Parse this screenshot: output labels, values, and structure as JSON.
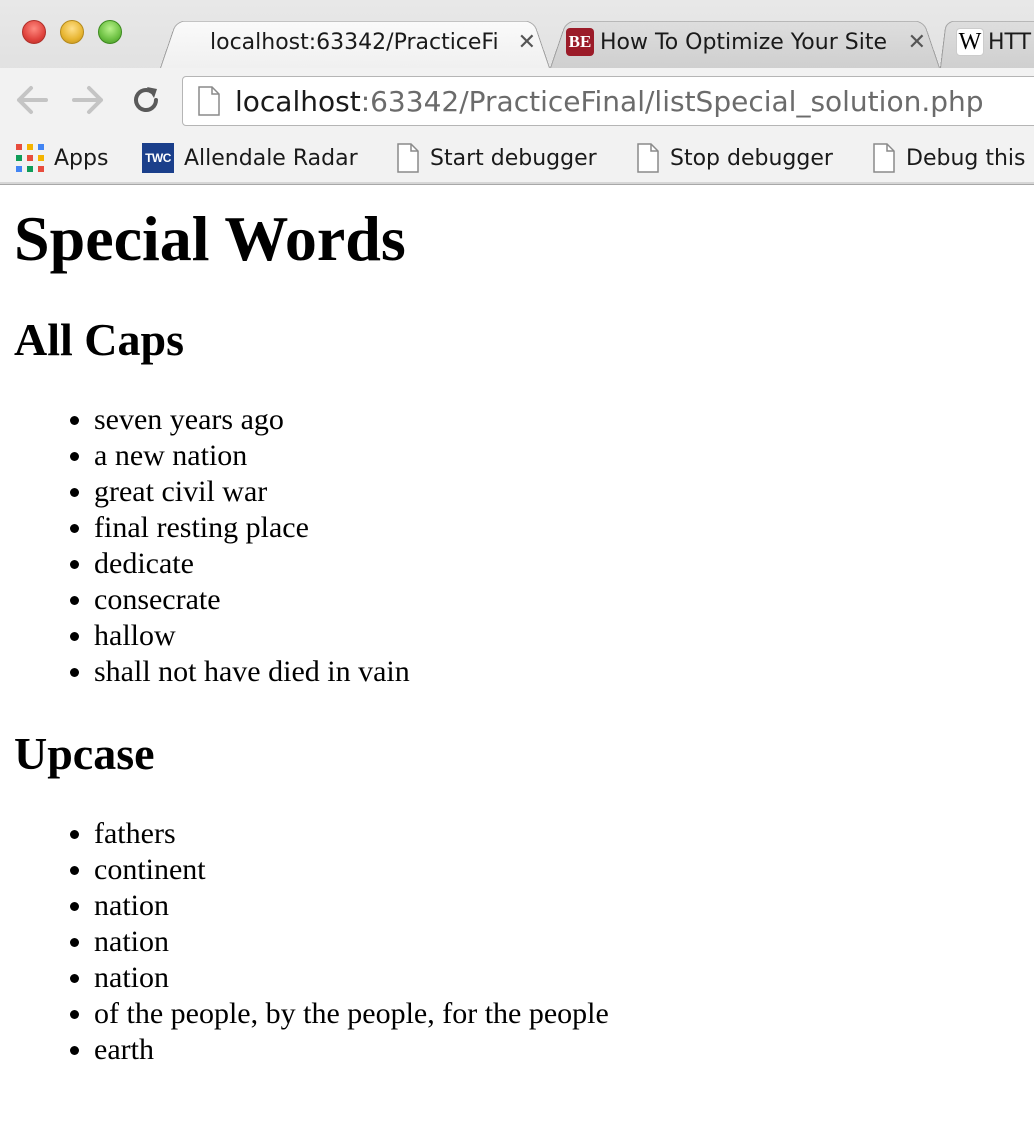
{
  "browser": {
    "tabs": [
      {
        "title": "localhost:63342/PracticeFi",
        "close": "✕",
        "active": true
      },
      {
        "title": "How To Optimize Your Site",
        "close": "✕",
        "active": false,
        "favicon_text": "BE"
      },
      {
        "title": "HTT",
        "active": false,
        "favicon_text": "W"
      }
    ],
    "url": {
      "host": "localhost",
      "rest": ":63342/PracticeFinal/listSpecial_solution.php"
    },
    "bookmarks": [
      {
        "label": "Apps",
        "icon": "apps-grid-icon"
      },
      {
        "label": "Allendale Radar",
        "icon": "twc-icon",
        "icon_text": "TWC"
      },
      {
        "label": "Start debugger",
        "icon": "page-icon"
      },
      {
        "label": "Stop debugger",
        "icon": "page-icon"
      },
      {
        "label": "Debug this",
        "icon": "page-icon"
      }
    ],
    "colors": {
      "close_red": "#e0443e",
      "minimize_yellow": "#e7b531",
      "zoom_green": "#6cc042"
    }
  },
  "page": {
    "title": "Special Words",
    "sections": [
      {
        "heading": "All Caps",
        "items": [
          "seven years ago",
          "a new nation",
          "great civil war",
          "final resting place",
          "dedicate",
          "consecrate",
          "hallow",
          "shall not have died in vain"
        ]
      },
      {
        "heading": "Upcase",
        "items": [
          "fathers",
          "continent",
          "nation",
          "nation",
          "nation",
          "of the people, by the people, for the people",
          "earth"
        ]
      }
    ]
  }
}
